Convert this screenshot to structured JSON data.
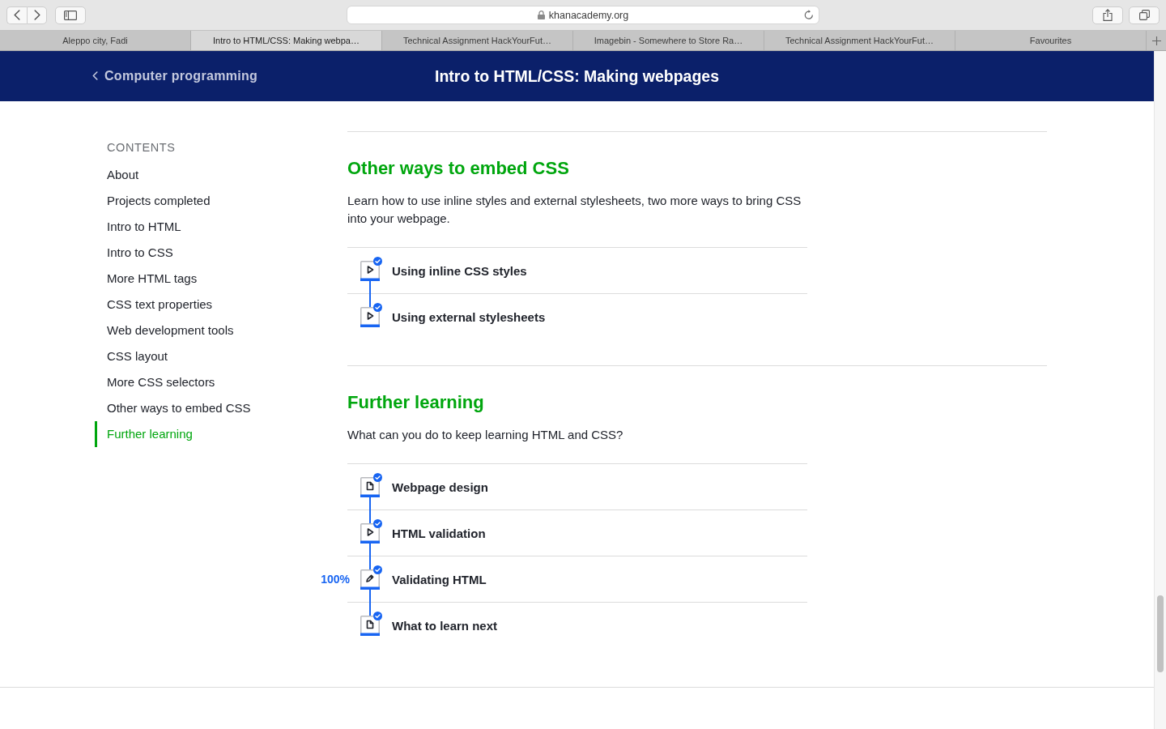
{
  "browser": {
    "url": "khanacademy.org",
    "tabs": [
      {
        "title": "Aleppo city, Fadi",
        "selected": false
      },
      {
        "title": "Intro to HTML/CSS: Making webpa…",
        "selected": true
      },
      {
        "title": "Technical Assignment HackYourFut…",
        "selected": false
      },
      {
        "title": "Imagebin - Somewhere to Store Ra…",
        "selected": false
      },
      {
        "title": "Technical Assignment HackYourFut…",
        "selected": false
      },
      {
        "title": "Favourites",
        "selected": false
      }
    ]
  },
  "header": {
    "back_link": "Computer programming",
    "title": "Intro to HTML/CSS: Making webpages"
  },
  "sidebar": {
    "heading": "CONTENTS",
    "items": [
      {
        "label": "About",
        "selected": false
      },
      {
        "label": "Projects completed",
        "selected": false
      },
      {
        "label": "Intro to HTML",
        "selected": false
      },
      {
        "label": "Intro to CSS",
        "selected": false
      },
      {
        "label": "More HTML tags",
        "selected": false
      },
      {
        "label": "CSS text properties",
        "selected": false
      },
      {
        "label": "Web development tools",
        "selected": false
      },
      {
        "label": "CSS layout",
        "selected": false
      },
      {
        "label": "More CSS selectors",
        "selected": false
      },
      {
        "label": "Other ways to embed CSS",
        "selected": false
      },
      {
        "label": "Further learning",
        "selected": true
      }
    ]
  },
  "sections": [
    {
      "title": "Other ways to embed CSS",
      "description": "Learn how to use inline styles and external stylesheets, two more ways to bring CSS into your webpage.",
      "lessons": [
        {
          "kind": "video",
          "title": "Using inline CSS styles",
          "completed": true
        },
        {
          "kind": "video",
          "title": "Using external stylesheets",
          "completed": true
        }
      ]
    },
    {
      "title": "Further learning",
      "description": "What can you do to keep learning HTML and CSS?",
      "lessons": [
        {
          "kind": "article",
          "title": "Webpage design",
          "completed": true
        },
        {
          "kind": "video",
          "title": "HTML validation",
          "completed": true
        },
        {
          "kind": "exercise",
          "title": "Validating HTML",
          "completed": true,
          "progress": "100%"
        },
        {
          "kind": "article",
          "title": "What to learn next",
          "completed": true
        }
      ]
    }
  ]
}
